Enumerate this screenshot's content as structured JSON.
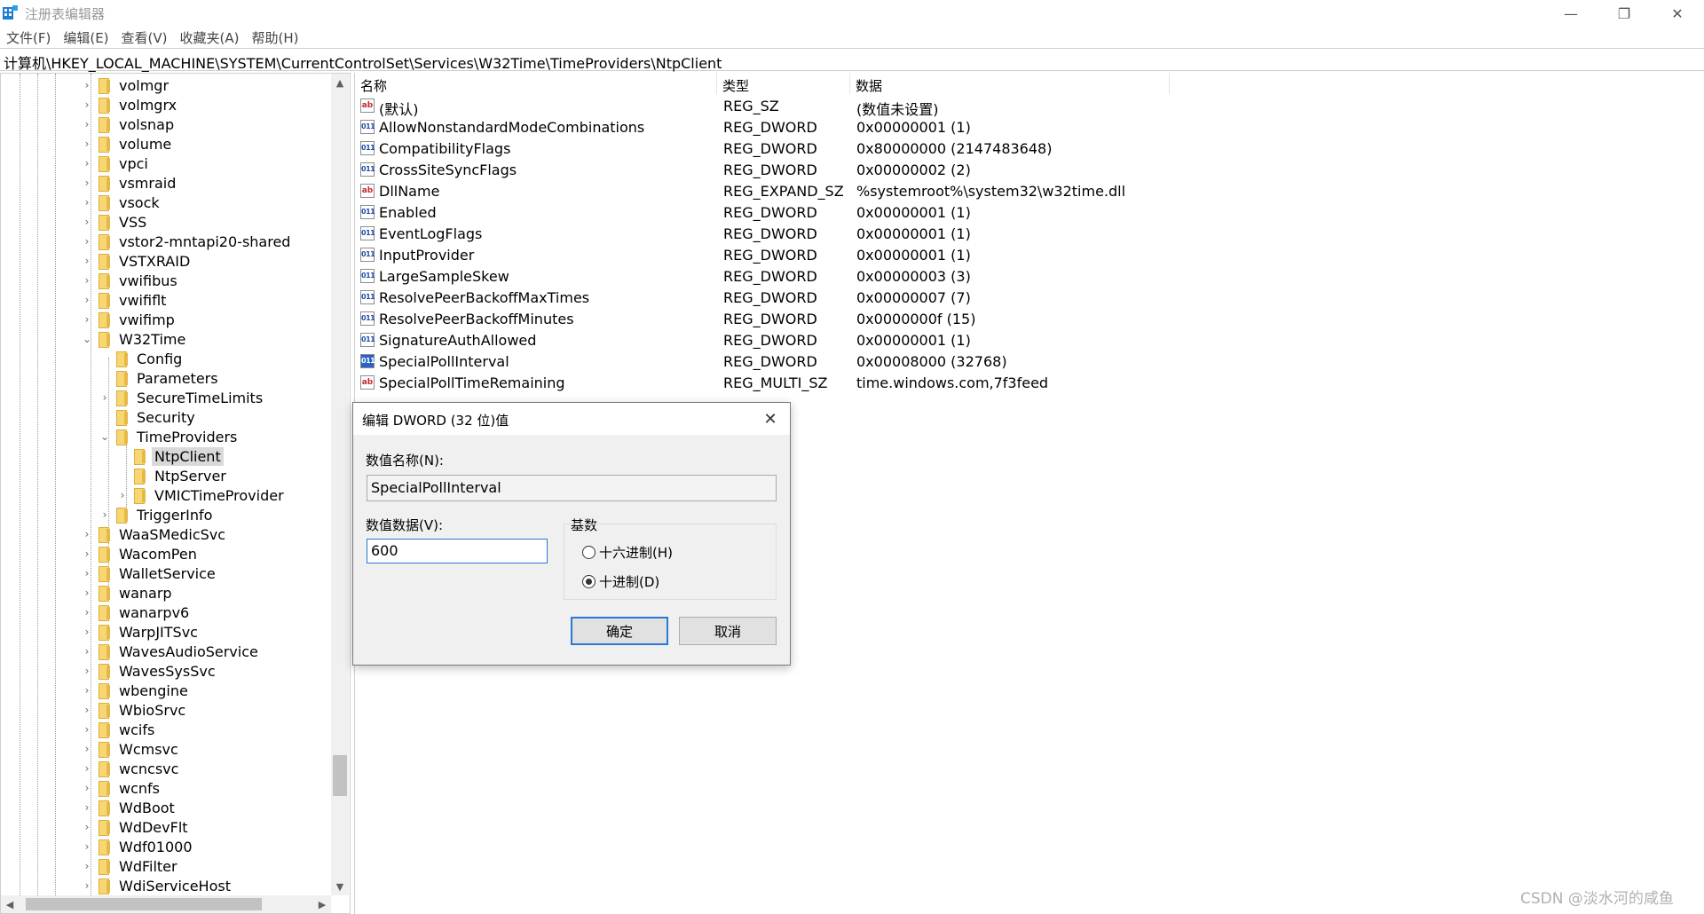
{
  "window": {
    "title": "注册表编辑器",
    "minimize_glyph": "—",
    "maximize_glyph": "❐",
    "close_glyph": "✕"
  },
  "menu": [
    "文件(F)",
    "编辑(E)",
    "查看(V)",
    "收藏夹(A)",
    "帮助(H)"
  ],
  "address": "计算机\\HKEY_LOCAL_MACHINE\\SYSTEM\\CurrentControlSet\\Services\\W32Time\\TimeProviders\\NtpClient",
  "tree": [
    {
      "label": "volmgr",
      "level": 0,
      "expander": ">"
    },
    {
      "label": "volmgrx",
      "level": 0,
      "expander": ">"
    },
    {
      "label": "volsnap",
      "level": 0,
      "expander": ">"
    },
    {
      "label": "volume",
      "level": 0,
      "expander": ">"
    },
    {
      "label": "vpci",
      "level": 0,
      "expander": ">"
    },
    {
      "label": "vsmraid",
      "level": 0,
      "expander": ">"
    },
    {
      "label": "vsock",
      "level": 0,
      "expander": ">"
    },
    {
      "label": "VSS",
      "level": 0,
      "expander": ">"
    },
    {
      "label": "vstor2-mntapi20-shared",
      "level": 0,
      "expander": ">"
    },
    {
      "label": "VSTXRAID",
      "level": 0,
      "expander": ">"
    },
    {
      "label": "vwifibus",
      "level": 0,
      "expander": ">"
    },
    {
      "label": "vwififlt",
      "level": 0,
      "expander": ">"
    },
    {
      "label": "vwifimp",
      "level": 0,
      "expander": ">"
    },
    {
      "label": "W32Time",
      "level": 0,
      "expander": "v"
    },
    {
      "label": "Config",
      "level": 1,
      "expander": ""
    },
    {
      "label": "Parameters",
      "level": 1,
      "expander": ""
    },
    {
      "label": "SecureTimeLimits",
      "level": 1,
      "expander": ">"
    },
    {
      "label": "Security",
      "level": 1,
      "expander": ""
    },
    {
      "label": "TimeProviders",
      "level": 1,
      "expander": "v"
    },
    {
      "label": "NtpClient",
      "level": 2,
      "expander": "",
      "selected": true
    },
    {
      "label": "NtpServer",
      "level": 2,
      "expander": ""
    },
    {
      "label": "VMICTimeProvider",
      "level": 2,
      "expander": ">"
    },
    {
      "label": "TriggerInfo",
      "level": 1,
      "expander": ">"
    },
    {
      "label": "WaaSMedicSvc",
      "level": 0,
      "expander": ">"
    },
    {
      "label": "WacomPen",
      "level": 0,
      "expander": ">"
    },
    {
      "label": "WalletService",
      "level": 0,
      "expander": ">"
    },
    {
      "label": "wanarp",
      "level": 0,
      "expander": ">"
    },
    {
      "label": "wanarpv6",
      "level": 0,
      "expander": ">"
    },
    {
      "label": "WarpJITSvc",
      "level": 0,
      "expander": ">"
    },
    {
      "label": "WavesAudioService",
      "level": 0,
      "expander": ">"
    },
    {
      "label": "WavesSysSvc",
      "level": 0,
      "expander": ">"
    },
    {
      "label": "wbengine",
      "level": 0,
      "expander": ">"
    },
    {
      "label": "WbioSrvc",
      "level": 0,
      "expander": ">"
    },
    {
      "label": "wcifs",
      "level": 0,
      "expander": ">"
    },
    {
      "label": "Wcmsvc",
      "level": 0,
      "expander": ">"
    },
    {
      "label": "wcncsvc",
      "level": 0,
      "expander": ">"
    },
    {
      "label": "wcnfs",
      "level": 0,
      "expander": ">"
    },
    {
      "label": "WdBoot",
      "level": 0,
      "expander": ">"
    },
    {
      "label": "WdDevFlt",
      "level": 0,
      "expander": ">"
    },
    {
      "label": "Wdf01000",
      "level": 0,
      "expander": ">"
    },
    {
      "label": "WdFilter",
      "level": 0,
      "expander": ">"
    },
    {
      "label": "WdiServiceHost",
      "level": 0,
      "expander": ">"
    }
  ],
  "list": {
    "headers": {
      "name": "名称",
      "type": "类型",
      "data": "数据"
    },
    "rows": [
      {
        "name": "(默认)",
        "type": "REG_SZ",
        "data": "(数值未设置)",
        "icon": "string-value-icon"
      },
      {
        "name": "AllowNonstandardModeCombinations",
        "type": "REG_DWORD",
        "data": "0x00000001 (1)",
        "icon": "dword-value-icon"
      },
      {
        "name": "CompatibilityFlags",
        "type": "REG_DWORD",
        "data": "0x80000000 (2147483648)",
        "icon": "dword-value-icon"
      },
      {
        "name": "CrossSiteSyncFlags",
        "type": "REG_DWORD",
        "data": "0x00000002 (2)",
        "icon": "dword-value-icon"
      },
      {
        "name": "DllName",
        "type": "REG_EXPAND_SZ",
        "data": "%systemroot%\\system32\\w32time.dll",
        "icon": "string-value-icon"
      },
      {
        "name": "Enabled",
        "type": "REG_DWORD",
        "data": "0x00000001 (1)",
        "icon": "dword-value-icon"
      },
      {
        "name": "EventLogFlags",
        "type": "REG_DWORD",
        "data": "0x00000001 (1)",
        "icon": "dword-value-icon"
      },
      {
        "name": "InputProvider",
        "type": "REG_DWORD",
        "data": "0x00000001 (1)",
        "icon": "dword-value-icon"
      },
      {
        "name": "LargeSampleSkew",
        "type": "REG_DWORD",
        "data": "0x00000003 (3)",
        "icon": "dword-value-icon"
      },
      {
        "name": "ResolvePeerBackoffMaxTimes",
        "type": "REG_DWORD",
        "data": "0x00000007 (7)",
        "icon": "dword-value-icon"
      },
      {
        "name": "ResolvePeerBackoffMinutes",
        "type": "REG_DWORD",
        "data": "0x0000000f (15)",
        "icon": "dword-value-icon"
      },
      {
        "name": "SignatureAuthAllowed",
        "type": "REG_DWORD",
        "data": "0x00000001 (1)",
        "icon": "dword-value-icon"
      },
      {
        "name": "SpecialPollInterval",
        "type": "REG_DWORD",
        "data": "0x00008000 (32768)",
        "icon": "dword-value-icon",
        "selected": true
      },
      {
        "name": "SpecialPollTimeRemaining",
        "type": "REG_MULTI_SZ",
        "data": "time.windows.com,7f3feed",
        "icon": "string-value-icon"
      }
    ]
  },
  "dialog": {
    "title": "编辑 DWORD (32 位)值",
    "name_label": "数值名称(N):",
    "name_value": "SpecialPollInterval",
    "data_label": "数值数据(V):",
    "data_value": "600",
    "base_label": "基数",
    "hex_label": "十六进制(H)",
    "dec_label": "十进制(D)",
    "selected_base": "decimal",
    "ok_label": "确定",
    "cancel_label": "取消"
  },
  "watermark": "CSDN @淡水河的咸鱼"
}
